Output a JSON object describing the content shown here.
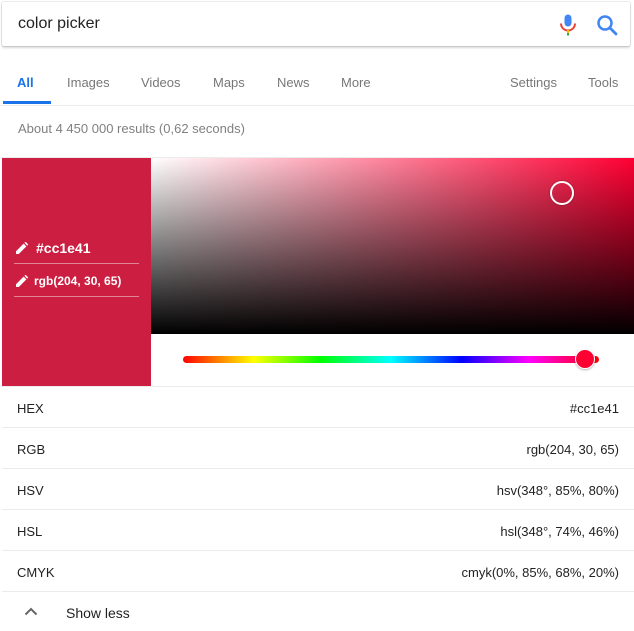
{
  "search": {
    "query": "color picker",
    "mic_icon": "mic-icon",
    "search_icon": "search-icon"
  },
  "tabs": {
    "items": [
      {
        "label": "All",
        "active": true
      },
      {
        "label": "Images"
      },
      {
        "label": "Videos"
      },
      {
        "label": "Maps"
      },
      {
        "label": "News"
      },
      {
        "label": "More"
      }
    ],
    "settings_label": "Settings",
    "tools_label": "Tools",
    "accent": "#1a73e8"
  },
  "result_stats": "About 4 450 000 results (0,62 seconds)",
  "color_picker": {
    "color": "#cc1e41",
    "hue_base": "#ff0033",
    "hex_label": "#cc1e41",
    "rgb_label": "rgb(204, 30, 65)",
    "saturation_fraction": 0.85,
    "value_fraction": 0.8,
    "hue_fraction": 0.967,
    "edit_icon": "pencil-icon"
  },
  "formats": [
    {
      "name": "HEX",
      "value": "#cc1e41"
    },
    {
      "name": "RGB",
      "value": "rgb(204, 30, 65)"
    },
    {
      "name": "HSV",
      "value": "hsv(348°, 85%, 80%)"
    },
    {
      "name": "HSL",
      "value": "hsl(348°, 74%, 46%)"
    },
    {
      "name": "CMYK",
      "value": "cmyk(0%, 85%, 68%, 20%)"
    }
  ],
  "show_less": {
    "label": "Show less",
    "icon": "chevron-up-icon"
  }
}
